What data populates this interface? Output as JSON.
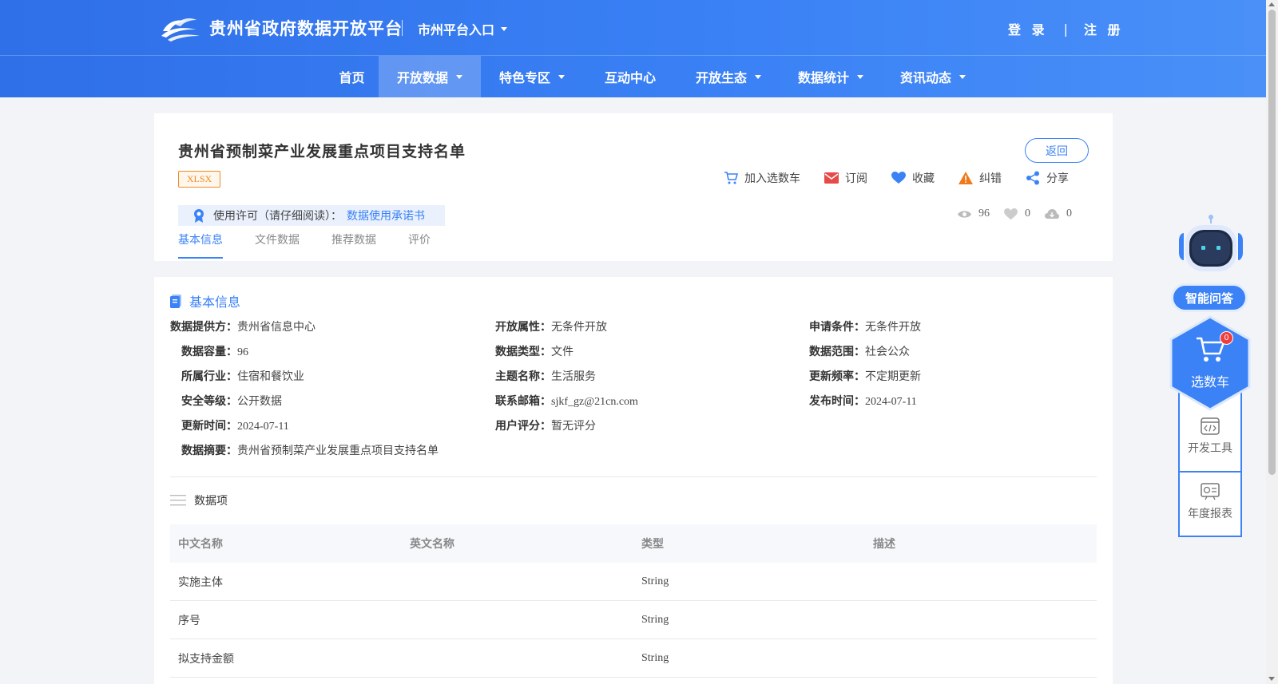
{
  "header": {
    "site_title": "贵州省政府数据开放平台",
    "city_entry": "市州平台入口",
    "login": "登 录",
    "auth_sep": "|",
    "register": "注 册"
  },
  "nav": {
    "items": [
      {
        "label": "首页"
      },
      {
        "label": "开放数据"
      },
      {
        "label": "特色专区"
      },
      {
        "label": "互动中心"
      },
      {
        "label": "开放生态"
      },
      {
        "label": "数据统计"
      },
      {
        "label": "资讯动态"
      }
    ]
  },
  "dataset": {
    "title": "贵州省预制菜产业发展重点项目支持名单",
    "format": "XLSX",
    "back": "返回",
    "actions": {
      "cart": "加入选数车",
      "subscribe": "订阅",
      "favorite": "收藏",
      "report": "纠错",
      "share": "分享"
    },
    "license_label": "使用许可（请仔细阅读）：",
    "license_link": "数据使用承诺书",
    "stats": {
      "views": "96",
      "likes": "0",
      "downloads": "0"
    },
    "tabs": [
      "基本信息",
      "文件数据",
      "推荐数据",
      "评价"
    ]
  },
  "basic_info": {
    "section_title": "基本信息",
    "fields": {
      "provider": {
        "label": "数据提供方：",
        "value": "贵州省信息中心"
      },
      "open_attr": {
        "label": "开放属性：",
        "value": "无条件开放"
      },
      "apply_cond": {
        "label": "申请条件：",
        "value": "无条件开放"
      },
      "capacity": {
        "label": "数据容量：",
        "value": "96"
      },
      "data_type": {
        "label": "数据类型：",
        "value": "文件"
      },
      "data_scope": {
        "label": "数据范围：",
        "value": "社会公众"
      },
      "industry": {
        "label": "所属行业：",
        "value": "住宿和餐饮业"
      },
      "topic": {
        "label": "主题名称：",
        "value": "生活服务"
      },
      "frequency": {
        "label": "更新频率：",
        "value": "不定期更新"
      },
      "security": {
        "label": "安全等级：",
        "value": "公开数据"
      },
      "email": {
        "label": "联系邮箱：",
        "value": "sjkf_gz@21cn.com"
      },
      "publish_time": {
        "label": "发布时间：",
        "value": "2024-07-11"
      },
      "update_time": {
        "label": "更新时间：",
        "value": "2024-07-11"
      },
      "rating": {
        "label": "用户评分：",
        "value": "暂无评分"
      },
      "summary": {
        "label": "数据摘要：",
        "value": "贵州省预制菜产业发展重点项目支持名单"
      }
    }
  },
  "data_items": {
    "title": "数据项",
    "columns": [
      "中文名称",
      "英文名称",
      "类型",
      "描述"
    ],
    "rows": [
      {
        "cn": "实施主体",
        "en": "",
        "type": "String",
        "desc": ""
      },
      {
        "cn": "序号",
        "en": "",
        "type": "String",
        "desc": ""
      },
      {
        "cn": "拟支持金额",
        "en": "",
        "type": "String",
        "desc": ""
      }
    ]
  },
  "side_widget": {
    "ai_label": "智能问答",
    "cart_label": "选数车",
    "cart_count": "0",
    "dev_tools": "开发工具",
    "annual_report": "年度报表"
  },
  "colors": {
    "primary": "#3b82f6",
    "header_start": "#2f6fe8",
    "tag_orange": "#f08a24",
    "mail_red": "#e84a4a",
    "warn_orange": "#f07a1a"
  }
}
